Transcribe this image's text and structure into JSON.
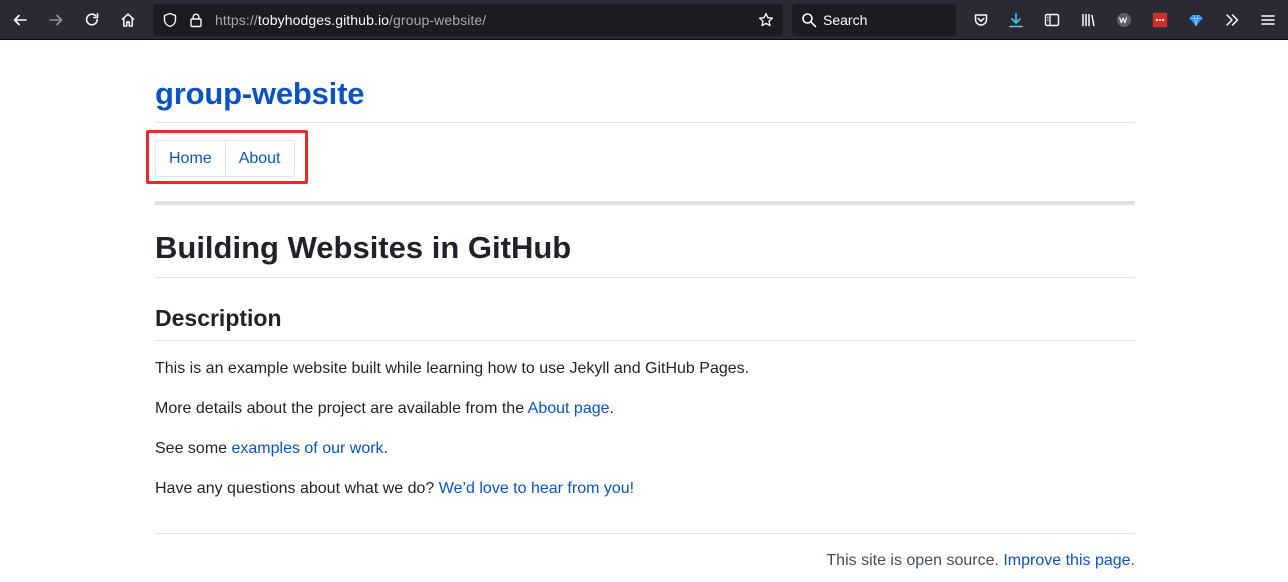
{
  "browser": {
    "url_scheme": "https://",
    "url_host": "tobyhodges.github.io",
    "url_path": "/group-website/",
    "search_placeholder": "Search",
    "icons": [
      "back-icon",
      "forward-icon",
      "reload-icon",
      "home-icon",
      "shield-icon",
      "lock-icon",
      "star-icon",
      "search-icon",
      "pocket-icon",
      "download-icon",
      "reader-view-icon",
      "library-icon",
      "wv-extension-icon",
      "red-extension-icon",
      "gem-extension-icon",
      "overflow-icon",
      "menu-icon"
    ]
  },
  "site": {
    "title": "group-website",
    "nav": [
      "Home",
      "About"
    ]
  },
  "content": {
    "h1": "Building Websites in GitHub",
    "h2": "Description",
    "p1": "This is an example website built while learning how to use Jekyll and GitHub Pages.",
    "p2_text": "More details about the project are available from the ",
    "p2_link": "About page",
    "p2_end": ".",
    "p3_text": "See some ",
    "p3_link": "examples of our work",
    "p3_end": ".",
    "p4_text": "Have any questions about what we do? ",
    "p4_link": "We’d love to hear from you!"
  },
  "footer": {
    "text": "This site is open source. ",
    "link": "Improve this page",
    "end": "."
  },
  "colors": {
    "link": "#0a53c7",
    "highlight": "#ea2a25",
    "toolbar": "#2b2a33"
  }
}
